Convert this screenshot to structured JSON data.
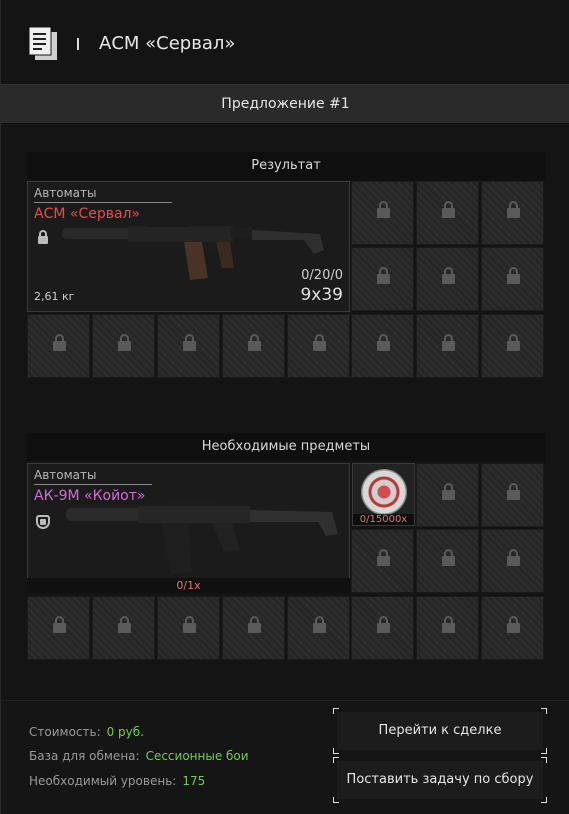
{
  "header": {
    "title": "АСМ «Сервал»",
    "icon": "documents-icon"
  },
  "offer": {
    "label": "Предложение #1"
  },
  "result": {
    "heading": "Результат",
    "item": {
      "category": "Автоматы",
      "name": "АСМ «Сервал»",
      "name_color": "#e84c4c",
      "weight": "2,61 кг",
      "ammo": "0/20/0",
      "caliber": "9x39",
      "status_icon": "lock-icon"
    }
  },
  "required": {
    "heading": "Необходимые предметы",
    "item": {
      "category": "Автоматы",
      "name": "АК-9М «Койот»",
      "name_color": "#d86ad8",
      "count": "0/1x",
      "status_icon": "shield-icon"
    },
    "currency": {
      "count": "0/15000x",
      "icon": "coin-icon"
    }
  },
  "footer": {
    "cost_label": "Стоимость:",
    "cost_value": "0 руб.",
    "base_label": "База для обмена:",
    "base_value": "Сессионные бои",
    "level_label": "Необходимый уровень:",
    "level_value": "175",
    "goto_deal": "Перейти к сделке",
    "set_task": "Поставить задачу по сбору"
  }
}
